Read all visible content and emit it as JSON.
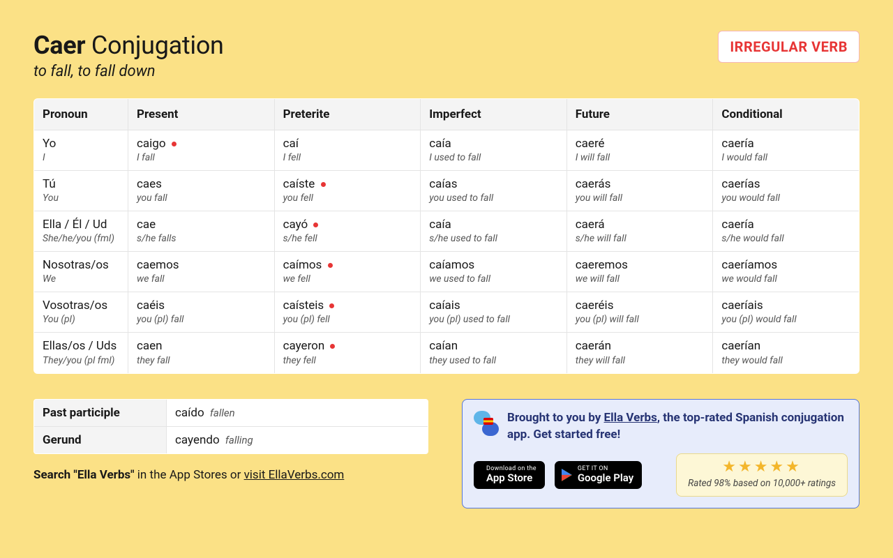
{
  "title_verb": "Caer",
  "title_rest": "Conjugation",
  "subtitle": "to fall, to fall down",
  "badge": "IRREGULAR VERB",
  "columns": [
    "Pronoun",
    "Present",
    "Preterite",
    "Imperfect",
    "Future",
    "Conditional"
  ],
  "rows": [
    {
      "pronoun": "Yo",
      "pronoun_gloss": "I",
      "present": {
        "form": "caigo",
        "gloss": "I fall",
        "irregular": true
      },
      "preterite": {
        "form": "caí",
        "gloss": "I fell",
        "irregular": false
      },
      "imperfect": {
        "form": "caía",
        "gloss": "I used to fall",
        "irregular": false
      },
      "future": {
        "form": "caeré",
        "gloss": "I will fall",
        "irregular": false
      },
      "conditional": {
        "form": "caería",
        "gloss": "I would fall",
        "irregular": false
      }
    },
    {
      "pronoun": "Tú",
      "pronoun_gloss": "You",
      "present": {
        "form": "caes",
        "gloss": "you fall",
        "irregular": false
      },
      "preterite": {
        "form": "caíste",
        "gloss": "you fell",
        "irregular": true
      },
      "imperfect": {
        "form": "caías",
        "gloss": "you used to fall",
        "irregular": false
      },
      "future": {
        "form": "caerás",
        "gloss": "you will fall",
        "irregular": false
      },
      "conditional": {
        "form": "caerías",
        "gloss": "you would fall",
        "irregular": false
      }
    },
    {
      "pronoun": "Ella / Él / Ud",
      "pronoun_gloss": "She/he/you (fml)",
      "present": {
        "form": "cae",
        "gloss": "s/he falls",
        "irregular": false
      },
      "preterite": {
        "form": "cayó",
        "gloss": "s/he fell",
        "irregular": true
      },
      "imperfect": {
        "form": "caía",
        "gloss": "s/he used to fall",
        "irregular": false
      },
      "future": {
        "form": "caerá",
        "gloss": "s/he will fall",
        "irregular": false
      },
      "conditional": {
        "form": "caería",
        "gloss": "s/he would fall",
        "irregular": false
      }
    },
    {
      "pronoun": "Nosotras/os",
      "pronoun_gloss": "We",
      "present": {
        "form": "caemos",
        "gloss": "we fall",
        "irregular": false
      },
      "preterite": {
        "form": "caímos",
        "gloss": "we fell",
        "irregular": true
      },
      "imperfect": {
        "form": "caíamos",
        "gloss": "we used to fall",
        "irregular": false
      },
      "future": {
        "form": "caeremos",
        "gloss": "we will fall",
        "irregular": false
      },
      "conditional": {
        "form": "caeríamos",
        "gloss": "we would fall",
        "irregular": false
      }
    },
    {
      "pronoun": "Vosotras/os",
      "pronoun_gloss": "You (pl)",
      "present": {
        "form": "caéis",
        "gloss": "you (pl) fall",
        "irregular": false
      },
      "preterite": {
        "form": "caísteis",
        "gloss": "you (pl) fell",
        "irregular": true
      },
      "imperfect": {
        "form": "caíais",
        "gloss": "you (pl) used to fall",
        "irregular": false
      },
      "future": {
        "form": "caeréis",
        "gloss": "you (pl) will fall",
        "irregular": false
      },
      "conditional": {
        "form": "caeríais",
        "gloss": "you (pl) would fall",
        "irregular": false
      }
    },
    {
      "pronoun": "Ellas/os / Uds",
      "pronoun_gloss": "They/you (pl fml)",
      "present": {
        "form": "caen",
        "gloss": "they fall",
        "irregular": false
      },
      "preterite": {
        "form": "cayeron",
        "gloss": "they fell",
        "irregular": true
      },
      "imperfect": {
        "form": "caían",
        "gloss": "they used to fall",
        "irregular": false
      },
      "future": {
        "form": "caerán",
        "gloss": "they will fall",
        "irregular": false
      },
      "conditional": {
        "form": "caerían",
        "gloss": "they would fall",
        "irregular": false
      }
    }
  ],
  "participles": {
    "past_label": "Past participle",
    "past_form": "caído",
    "past_gloss": "fallen",
    "gerund_label": "Gerund",
    "gerund_form": "cayendo",
    "gerund_gloss": "falling"
  },
  "cta": {
    "prefix": "Search \"Ella Verbs\"",
    "middle": " in the App Stores or ",
    "link": "visit EllaVerbs.com"
  },
  "promo": {
    "line_pre": "Brought to you by ",
    "link": "Ella Verbs",
    "line_post": ", the top-rated Spanish conjugation app. Get started free!",
    "appstore_l1": "Download on the",
    "appstore_l2": "App Store",
    "gplay_l1": "GET IT ON",
    "gplay_l2": "Google Play",
    "stars": "★★★★★",
    "rating_text": "Rated 98% based on 10,000+ ratings"
  }
}
